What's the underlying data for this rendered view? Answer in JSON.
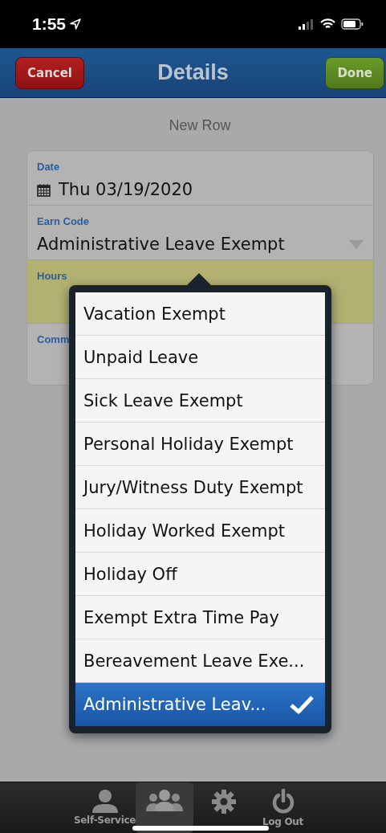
{
  "status_bar": {
    "time": "1:55"
  },
  "nav_bar": {
    "title": "Details",
    "buttons": [
      {
        "label": "Cancel",
        "kind": "cancel"
      },
      {
        "label": "Done",
        "kind": "done"
      }
    ]
  },
  "form": {
    "heading": "New Row",
    "fields": [
      {
        "label": "Date",
        "value": "Thu 03/19/2020",
        "kind": "date"
      },
      {
        "label": "Earn Code",
        "value": "Administrative Leave Exempt",
        "kind": "select"
      },
      {
        "label": "Hours",
        "kind": "highlighted"
      },
      {
        "label": "Comm",
        "kind": "plain"
      }
    ]
  },
  "picker": {
    "options": [
      {
        "label": "Vacation Exempt",
        "selected": false
      },
      {
        "label": "Unpaid Leave",
        "selected": false
      },
      {
        "label": "Sick Leave Exempt",
        "selected": false
      },
      {
        "label": "Personal Holiday Exempt",
        "selected": false
      },
      {
        "label": "Jury/Witness Duty Exempt",
        "selected": false
      },
      {
        "label": "Holiday Worked Exempt",
        "selected": false
      },
      {
        "label": "Holiday Off",
        "selected": false
      },
      {
        "label": "Exempt Extra Time Pay",
        "selected": false
      },
      {
        "label": "Bereavement Leave Exe...",
        "selected": false
      },
      {
        "label": "Administrative Leav...",
        "selected": true
      }
    ]
  },
  "tab_bar": {
    "tabs": [
      {
        "label": "Self-Service",
        "kind": "person",
        "selected": false
      },
      {
        "kind": "people",
        "selected": true
      },
      {
        "kind": "gear",
        "selected": false
      },
      {
        "label": "Log Out",
        "kind": "power",
        "selected": false
      }
    ]
  }
}
